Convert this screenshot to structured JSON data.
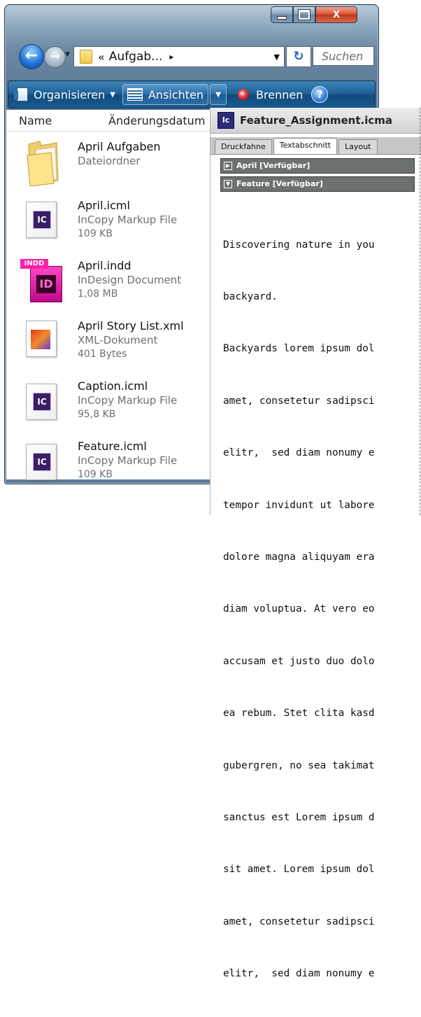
{
  "explorer": {
    "window_buttons": {
      "minimize": "",
      "maximize": "",
      "close": "X"
    },
    "breadcrumb": {
      "chevron": "«",
      "text": "Aufgab...",
      "arrow": "▸"
    },
    "search": {
      "placeholder": "Suchen"
    },
    "toolbar": {
      "organize": "Organisieren",
      "views": "Ansichten",
      "burn": "Brennen",
      "help": "?"
    },
    "columns": {
      "name": "Name",
      "modified": "Änderungsdatum"
    },
    "files": [
      {
        "name": "April Aufgaben",
        "type": "Dateiordner",
        "size": "",
        "icon": "folder-icon"
      },
      {
        "name": "April.icml",
        "type": "InCopy Markup File",
        "size": "109 KB",
        "icon": "incopy-file-icon"
      },
      {
        "name": "April.indd",
        "type": "InDesign Document",
        "size": "1,08 MB",
        "icon": "indesign-file-icon"
      },
      {
        "name": "April Story List.xml",
        "type": "XML-Dokument",
        "size": "401 Bytes",
        "icon": "xml-file-icon"
      },
      {
        "name": "Caption.icml",
        "type": "InCopy Markup File",
        "size": "95,8 KB",
        "icon": "incopy-file-icon"
      },
      {
        "name": "Feature.icml",
        "type": "InCopy Markup File",
        "size": "109 KB",
        "icon": "incopy-file-icon"
      }
    ],
    "badges": {
      "ic": "IC",
      "indd_tag": "INDD",
      "indd": "ID"
    }
  },
  "panel": {
    "title": "Feature_Assignment.icma",
    "app_badge": "Ic",
    "tabs": [
      "Druckfahne",
      "Textabschnitt",
      "Layout"
    ],
    "active_tab": "Textabschnitt",
    "sections": [
      {
        "label": "April [Verfügbar]",
        "state": "collapsed"
      },
      {
        "label": "Feature [Verfügbar]",
        "state": "expanded"
      }
    ],
    "story_lines": [
      "Discovering nature in you",
      "backyard.",
      "Backyards lorem ipsum dol",
      "amet, consetetur sadipsci",
      "elitr,  sed diam nonumy e",
      "tempor invidunt ut labore",
      "dolore magna aliquyam era",
      "diam voluptua. At vero eo",
      "accusam et justo duo dolo",
      "ea rebum. Stet clita kasd",
      "gubergren, no sea takimat",
      "sanctus est Lorem ipsum d",
      "sit amet. Lorem ipsum dol",
      "amet, consetetur sadipsci",
      "elitr,  sed diam nonumy e"
    ]
  }
}
